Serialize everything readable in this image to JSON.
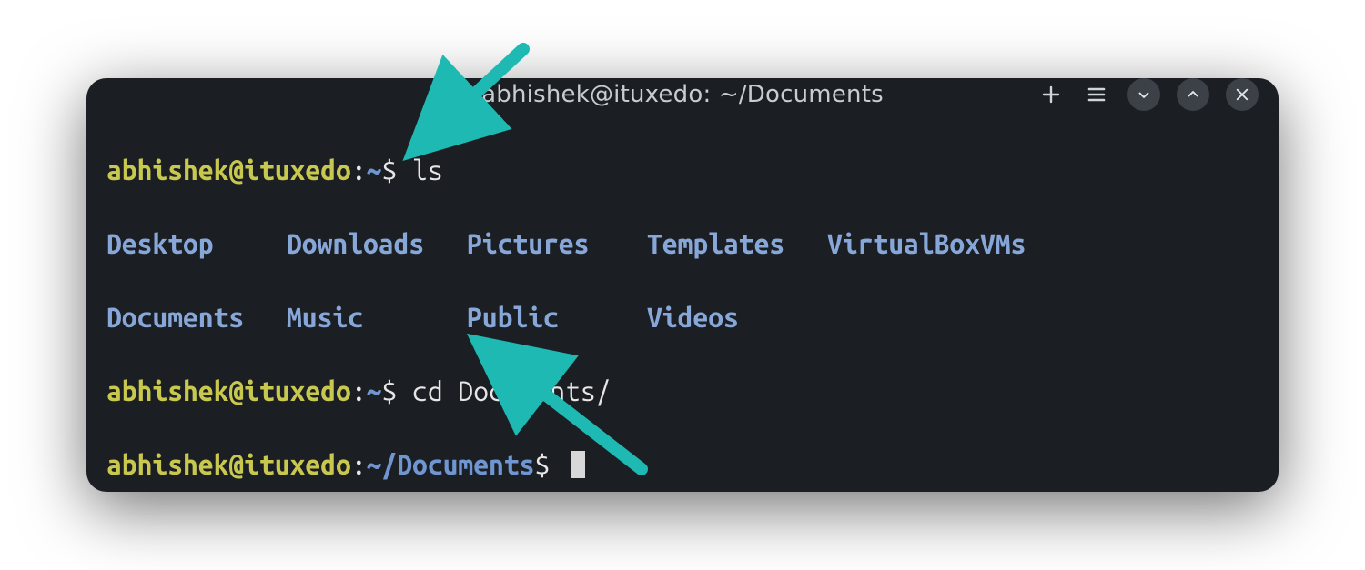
{
  "colors": {
    "accent_arrow": "#1fb9b3",
    "terminal_bg": "#1b1f24",
    "prompt_user": "#c8c84f",
    "prompt_path": "#6f96d1",
    "directory": "#88a7d9",
    "titlebar_text": "#c6ccd2"
  },
  "titlebar": {
    "title": "abhishek@ituxedo: ~/Documents"
  },
  "prompt1": {
    "user_host": "abhishek@ituxedo",
    "separator": ":",
    "path": "~",
    "dollar": "$ ",
    "command": "ls"
  },
  "ls_output": {
    "row1": {
      "c1": "Desktop",
      "c2": "Downloads",
      "c3": "Pictures",
      "c4": "Templates",
      "c5": "VirtualBoxVMs"
    },
    "row2": {
      "c1": "Documents",
      "c2": "Music",
      "c3": "Public",
      "c4": "Videos"
    }
  },
  "prompt2": {
    "user_host": "abhishek@ituxedo",
    "separator": ":",
    "path": "~",
    "dollar": "$ ",
    "command": "cd Documents/"
  },
  "prompt3": {
    "user_host": "abhishek@ituxedo",
    "separator": ":",
    "path": "~/Documents",
    "dollar": "$ "
  }
}
